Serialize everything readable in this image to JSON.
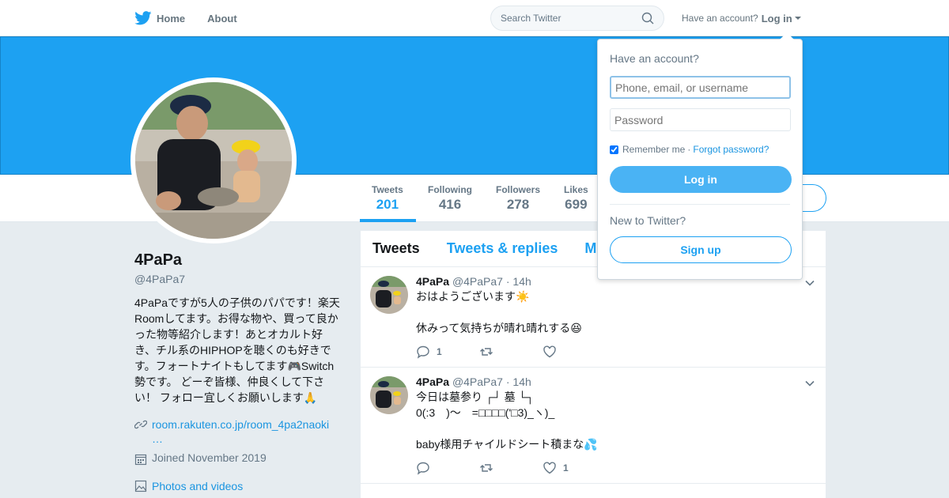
{
  "nav": {
    "home_label": "Home",
    "about_label": "About",
    "search_placeholder": "Search Twitter",
    "have_account": "Have an account?",
    "login_label": "Log in"
  },
  "profile": {
    "name": "4PaPa",
    "handle": "@4PaPa7",
    "bio": "4PaPaですが5人の子供のパパです！楽天Roomしてます。お得な物や、買って良かった物等紹介します！あとオカルト好き、チル系のHIPHOPを聴くのも好きです。フォートナイトもしてます🎮Switch勢です。 どーぞ皆様、仲良くして下さい！ フォロー宜しくお願いします🙏",
    "link": "room.rakuten.co.jp/room_4pa2naoki",
    "link_ellipsis": "…",
    "joined": "Joined November 2019",
    "photos": "Photos and videos"
  },
  "stats": [
    {
      "label": "Tweets",
      "value": "201"
    },
    {
      "label": "Following",
      "value": "416"
    },
    {
      "label": "Followers",
      "value": "278"
    },
    {
      "label": "Likes",
      "value": "699"
    }
  ],
  "tabs": [
    "Tweets",
    "Tweets & replies",
    "M"
  ],
  "tweets": [
    {
      "name": "4PaPa",
      "handle": "@4PaPa7",
      "time": "· 14h",
      "line1": "おはようございます☀️",
      "line2": "",
      "line3": "休みって気持ちが晴れ晴れする😆",
      "replies": "1",
      "retweets": "",
      "likes": ""
    },
    {
      "name": "4PaPa",
      "handle": "@4PaPa7",
      "time": "· 14h",
      "line1": "今日は墓参り ┌┘ 墓 └┐",
      "line2": "0(:3　)～　=□□□□('□3)_ヽ)_",
      "line3": "baby様用チャイルドシート積まな💦",
      "replies": "",
      "retweets": "",
      "likes": "1"
    }
  ],
  "login_dropdown": {
    "title": "Have an account?",
    "username_placeholder": "Phone, email, or username",
    "password_placeholder": "Password",
    "remember": "Remember me",
    "sep": "·",
    "forgot": "Forgot password?",
    "login_button": "Log in",
    "new_to": "New to Twitter?",
    "signup_button": "Sign up"
  },
  "colors": {
    "brand": "#1da1f2",
    "background": "#e6ecf0"
  }
}
